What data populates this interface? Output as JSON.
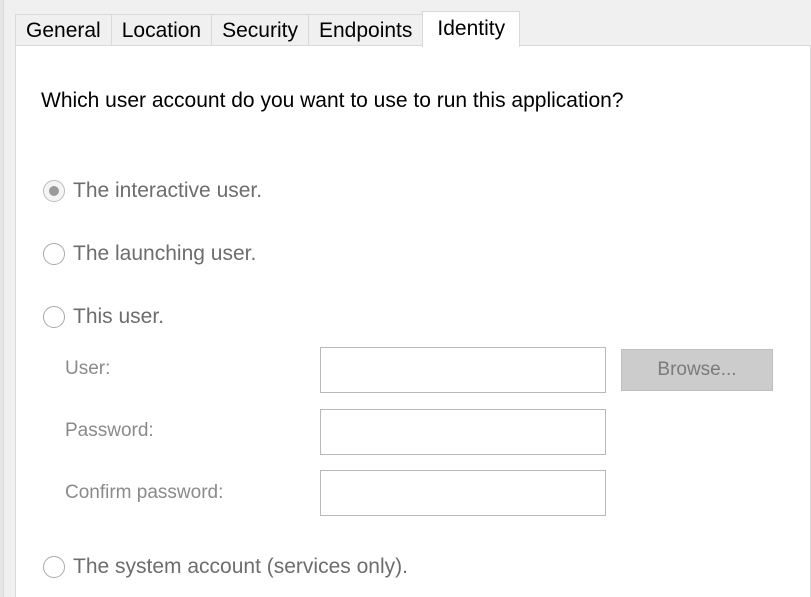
{
  "tabs": [
    {
      "label": "General",
      "active": false
    },
    {
      "label": "Location",
      "active": false
    },
    {
      "label": "Security",
      "active": false
    },
    {
      "label": "Endpoints",
      "active": false
    },
    {
      "label": "Identity",
      "active": true
    }
  ],
  "identity": {
    "question": "Which user account do you want to use to run this application?",
    "options": [
      {
        "label": "The interactive user.",
        "selected": true,
        "enabled": false
      },
      {
        "label": "The launching user.",
        "selected": false,
        "enabled": false
      },
      {
        "label": "This user.",
        "selected": false,
        "enabled": false
      },
      {
        "label": "The system account (services only).",
        "selected": false,
        "enabled": false
      }
    ],
    "fields": {
      "user_label": "User:",
      "user_value": "",
      "password_label": "Password:",
      "password_value": "",
      "confirm_label": "Confirm password:",
      "confirm_value": ""
    },
    "browse_label": "Browse..."
  },
  "colors": {
    "panel_background": "#ffffff",
    "window_background": "#f0f0f0",
    "disabled_text": "#6d6d6d",
    "disabled_button": "#cccccc"
  }
}
